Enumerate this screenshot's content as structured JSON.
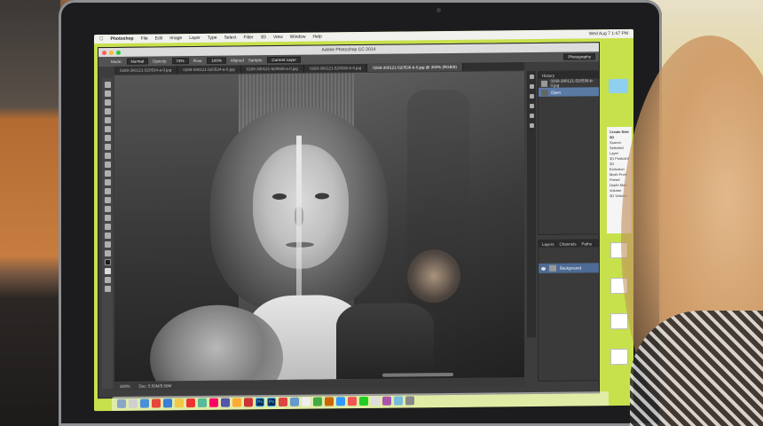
{
  "menubar": {
    "app_name": "Photoshop",
    "items": [
      "File",
      "Edit",
      "Image",
      "Layer",
      "Type",
      "Select",
      "Filter",
      "3D",
      "View",
      "Window",
      "Help"
    ],
    "clock": "Wed Aug 7 1:47 PM"
  },
  "window": {
    "title": "Adobe Photoshop CC 2014"
  },
  "options_bar": {
    "mode_label": "Mode:",
    "mode_value": "Normal",
    "opacity_label": "Opacity:",
    "opacity_value": "74%",
    "flow_label": "Flow:",
    "flow_value": "100%",
    "aligned_label": "Aligned",
    "sample_label": "Sample:",
    "sample_value": "Current Layer",
    "workspace": "Photography"
  },
  "doc_tabs": [
    "0269-380121-520534-a-0.jpg",
    "0269-380121-520534-a-0.jpg",
    "0269-380121-520535-a-0.jpg",
    "0269-380121-520536-b-0.jpg",
    "0269-380121-520536-b-0.jpg @ 300% (RGB/8)"
  ],
  "status_bar": {
    "zoom": "300%",
    "doc_size": "Doc: 5.59M/5.59M"
  },
  "history_panel": {
    "title": "History",
    "snapshot": "0269-380121-520536-b-0.jpg",
    "rows": [
      "Open"
    ]
  },
  "layers_panel": {
    "tabs": [
      "Layers",
      "Channels",
      "Paths"
    ],
    "layer_name": "Background"
  },
  "notification": {
    "title": "Create New 3D",
    "lines": [
      "Source: Selected Layer",
      "3D Postcard",
      "3D Extrusion",
      "Mesh From Preset",
      "Depth Map",
      "Volume",
      "3D Volume"
    ]
  },
  "colors": {
    "desktop_bg": "#c6e14c",
    "layer_selected": "#4d6b94",
    "history_selected": "#5a7aa5",
    "ps_accent": "#31a8ff"
  },
  "dock": {
    "ps_label_1": "Ps",
    "ps_label_2": "Ps"
  }
}
